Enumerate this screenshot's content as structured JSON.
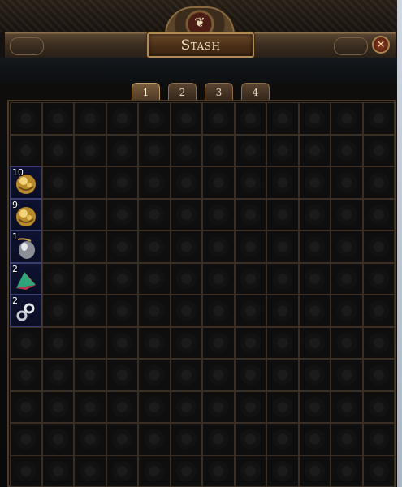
{
  "window": {
    "title": "Stash",
    "emblem_icon": "pouch-emblem-icon",
    "close_icon": "close-icon"
  },
  "tabs": [
    {
      "label": "1",
      "active": true
    },
    {
      "label": "2",
      "active": false
    },
    {
      "label": "3",
      "active": false
    },
    {
      "label": "4",
      "active": false
    }
  ],
  "grid": {
    "columns": 12,
    "rows": 12,
    "items": [
      {
        "row": 3,
        "col": 1,
        "name": "gold-orb-icon",
        "stack": "10"
      },
      {
        "row": 4,
        "col": 1,
        "name": "gold-orb-icon",
        "stack": "9"
      },
      {
        "row": 5,
        "col": 1,
        "name": "silver-orb-icon",
        "stack": "1"
      },
      {
        "row": 6,
        "col": 1,
        "name": "prismatic-shard-icon",
        "stack": "2"
      },
      {
        "row": 7,
        "col": 1,
        "name": "chain-ring-icon",
        "stack": "2"
      }
    ]
  },
  "colors": {
    "panel_bg": "#0c0c0c",
    "item_slot_bg": "#0e1230",
    "header_gold": "#b08a52",
    "title_text": "#f1e3c2"
  }
}
